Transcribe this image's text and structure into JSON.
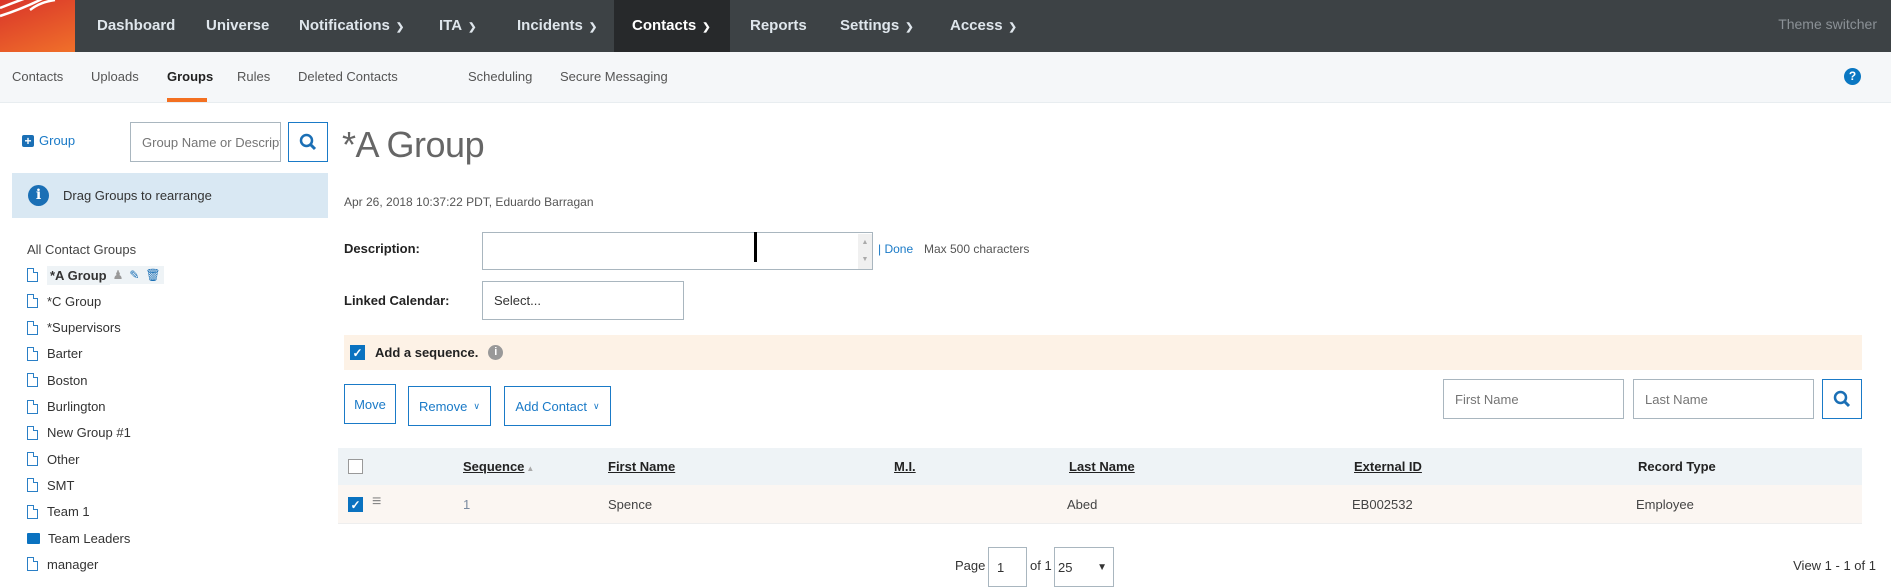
{
  "topnav": {
    "items": [
      {
        "label": "Dashboard"
      },
      {
        "label": "Universe"
      },
      {
        "label": "Notifications"
      },
      {
        "label": "ITA"
      },
      {
        "label": "Incidents"
      },
      {
        "label": "Contacts"
      },
      {
        "label": "Reports"
      },
      {
        "label": "Settings"
      },
      {
        "label": "Access"
      }
    ],
    "active": "Contacts",
    "theme_switcher": "Theme switcher",
    "brand_color": "#f37021"
  },
  "subnav": {
    "items": [
      {
        "label": "Contacts"
      },
      {
        "label": "Uploads"
      },
      {
        "label": "Groups"
      },
      {
        "label": "Rules"
      },
      {
        "label": "Deleted Contacts"
      },
      {
        "label": "Scheduling"
      },
      {
        "label": "Secure Messaging"
      }
    ],
    "active": "Groups",
    "help_icon": "?"
  },
  "sidebar": {
    "add_group": "Group",
    "search_placeholder": "Group Name or Description",
    "info": "Drag Groups to rearrange",
    "root": "All Contact Groups",
    "groups": [
      {
        "label": "*A Group",
        "icon": "document"
      },
      {
        "label": "*C Group",
        "icon": "document"
      },
      {
        "label": "*Supervisors",
        "icon": "document"
      },
      {
        "label": "Barter",
        "icon": "document"
      },
      {
        "label": "Boston",
        "icon": "document"
      },
      {
        "label": "Burlington",
        "icon": "document"
      },
      {
        "label": "New Group #1",
        "icon": "document"
      },
      {
        "label": "Other",
        "icon": "document"
      },
      {
        "label": "SMT",
        "icon": "document"
      },
      {
        "label": "Team 1",
        "icon": "document"
      },
      {
        "label": "Team Leaders",
        "icon": "folder"
      },
      {
        "label": "manager",
        "icon": "document"
      }
    ]
  },
  "main": {
    "title": "*A Group",
    "meta": "Apr 26, 2018 10:37:22 PDT, Eduardo Barragan",
    "description_label": "Description:",
    "description_value": "",
    "done": "| Done",
    "max_chars": "Max 500 characters",
    "calendar_label": "Linked Calendar:",
    "calendar_value": "Select...",
    "sequence_label": "Add a sequence.",
    "sequence_checked": true,
    "buttons": {
      "move": "Move",
      "remove": "Remove",
      "add_contact": "Add Contact"
    },
    "search": {
      "first_placeholder": "First Name",
      "last_placeholder": "Last Name"
    },
    "table": {
      "headers": [
        "Sequence",
        "First Name",
        "M.I.",
        "Last Name",
        "External ID",
        "Record Type"
      ],
      "rows": [
        {
          "checked": true,
          "sequence": "1",
          "first": "Spence",
          "mi": "",
          "last": "Abed",
          "external_id": "EB002532",
          "record_type": "Employee"
        }
      ]
    },
    "pagination": {
      "page_label": "Page",
      "page": "1",
      "of": "of 1",
      "page_size": "25",
      "view": "View 1 - 1 of 1"
    }
  }
}
